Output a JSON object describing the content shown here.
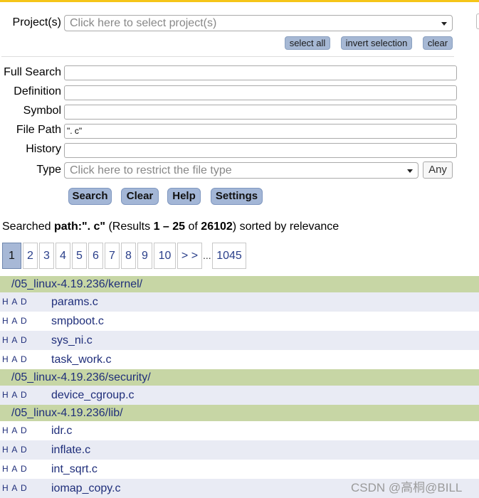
{
  "form": {
    "project_label": "Project(s)",
    "project_placeholder": "Click here to select project(s)",
    "select_all": "select all",
    "invert_selection": "invert selection",
    "clear_small": "clear",
    "full_search_label": "Full Search",
    "full_search_value": "",
    "definition_label": "Definition",
    "definition_value": "",
    "symbol_label": "Symbol",
    "symbol_value": "",
    "file_path_label": "File Path",
    "file_path_value": "\". c\"",
    "history_label": "History",
    "history_value": "",
    "type_label": "Type",
    "type_placeholder": "Click here to restrict the file type",
    "any_button": "Any",
    "search_button": "Search",
    "clear_button": "Clear",
    "help_button": "Help",
    "settings_button": "Settings"
  },
  "summary": {
    "prefix": "Searched ",
    "query": "path:\". c\"",
    "results_open": " (Results ",
    "range": "1 – 25",
    "of": " of ",
    "total": "26102",
    "suffix": ") sorted by relevance"
  },
  "pagination": {
    "pages": [
      "1",
      "2",
      "3",
      "4",
      "5",
      "6",
      "7",
      "8",
      "9",
      "10",
      "> >"
    ],
    "ellipsis": "...",
    "last": "1045",
    "active": "1"
  },
  "results": {
    "had_label": "H A D",
    "groups": [
      {
        "dir": "/05_linux-4.19.236/kernel/",
        "files": [
          "params.c",
          "smpboot.c",
          "sys_ni.c",
          "task_work.c"
        ]
      },
      {
        "dir": "/05_linux-4.19.236/security/",
        "files": [
          "device_cgroup.c"
        ]
      },
      {
        "dir": "/05_linux-4.19.236/lib/",
        "files": [
          "idr.c",
          "inflate.c",
          "int_sqrt.c",
          "iomap_copy.c"
        ]
      }
    ]
  },
  "watermark": "CSDN @高桐@BILL",
  "colors": {
    "accent_top": "#f5c518",
    "dir_row": "#c7d6a5",
    "button": "#a3b6d6",
    "link": "#1f2e7a"
  }
}
